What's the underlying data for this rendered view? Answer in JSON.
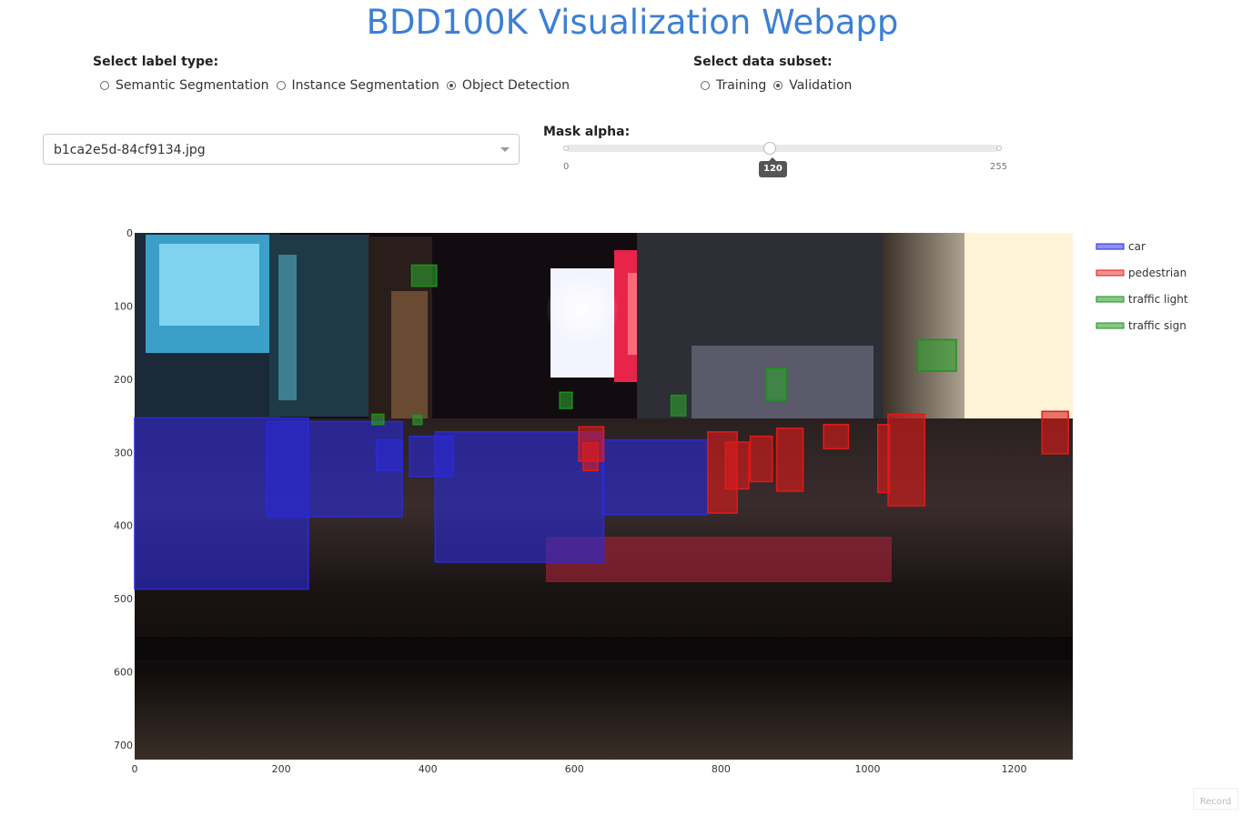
{
  "title": "BDD100K Visualization Webapp",
  "label_type": {
    "label": "Select label type:",
    "options": [
      {
        "label": "Semantic Segmentation",
        "checked": false
      },
      {
        "label": "Instance Segmentation",
        "checked": false
      },
      {
        "label": "Object Detection",
        "checked": true
      }
    ]
  },
  "data_subset": {
    "label": "Select data subset:",
    "options": [
      {
        "label": "Training",
        "checked": false
      },
      {
        "label": "Validation",
        "checked": true
      }
    ]
  },
  "image_select": {
    "value": "b1ca2e5d-84cf9134.jpg"
  },
  "mask_alpha": {
    "label": "Mask alpha:",
    "min": 0,
    "max": 255,
    "value": 120,
    "min_label": "0",
    "max_label": "255",
    "value_label": "120"
  },
  "plot": {
    "x_ticks": [
      "0",
      "200",
      "400",
      "600",
      "800",
      "1000",
      "1200"
    ],
    "y_ticks": [
      "0",
      "100",
      "200",
      "300",
      "400",
      "500",
      "600",
      "700"
    ],
    "xlim": [
      0,
      1280
    ],
    "ylim": [
      0,
      720
    ],
    "legend": [
      {
        "name": "car",
        "color": "#5555ee"
      },
      {
        "name": "pedestrian",
        "color": "#ee5555"
      },
      {
        "name": "traffic light",
        "color": "#44aa44"
      },
      {
        "name": "traffic sign",
        "color": "#44aa44"
      }
    ]
  },
  "record_label": "Record",
  "chart_data": {
    "type": "scatter",
    "xlim": [
      0,
      1280
    ],
    "ylim": [
      0,
      720
    ],
    "series": [
      {
        "name": "car",
        "boxes": [
          [
            0,
            253,
            237,
            487
          ],
          [
            180,
            258,
            365,
            388
          ],
          [
            330,
            283,
            365,
            325
          ],
          [
            375,
            278,
            435,
            333
          ],
          [
            410,
            272,
            640,
            450
          ],
          [
            638,
            283,
            782,
            385
          ]
        ]
      },
      {
        "name": "pedestrian",
        "boxes": [
          [
            606,
            265,
            640,
            312
          ],
          [
            612,
            287,
            632,
            325
          ],
          [
            782,
            272,
            822,
            383
          ],
          [
            806,
            286,
            838,
            350
          ],
          [
            840,
            278,
            870,
            340
          ],
          [
            876,
            267,
            912,
            353
          ],
          [
            940,
            262,
            974,
            295
          ],
          [
            1014,
            262,
            1030,
            355
          ],
          [
            1028,
            248,
            1078,
            373
          ],
          [
            1238,
            244,
            1274,
            302
          ]
        ]
      },
      {
        "name": "traffic light",
        "boxes": [
          [
            378,
            44,
            412,
            73
          ],
          [
            580,
            218,
            597,
            240
          ],
          [
            324,
            248,
            340,
            262
          ],
          [
            380,
            249,
            392,
            262
          ],
          [
            862,
            185,
            889,
            229
          ],
          [
            1068,
            146,
            1121,
            189
          ]
        ]
      },
      {
        "name": "traffic sign",
        "boxes": [
          [
            732,
            222,
            752,
            250
          ]
        ]
      }
    ]
  }
}
